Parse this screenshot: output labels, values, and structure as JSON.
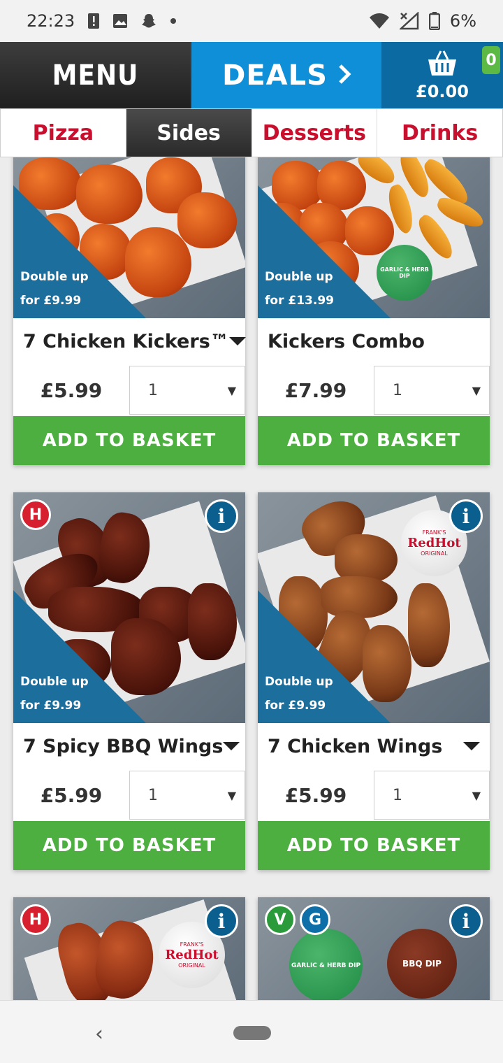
{
  "status_bar": {
    "time": "22:23",
    "battery": "6%"
  },
  "nav": {
    "menu_label": "MENU",
    "deals_label": "DEALS",
    "basket_total": "£0.00",
    "basket_count": "0"
  },
  "categories": [
    {
      "label": "Pizza",
      "active": false
    },
    {
      "label": "Sides",
      "active": true
    },
    {
      "label": "Desserts",
      "active": false
    },
    {
      "label": "Drinks",
      "active": false
    }
  ],
  "products": [
    {
      "title": "7 Chicken Kickers™",
      "price": "£5.99",
      "qty": "1",
      "promo_line1": "Double up",
      "promo_line2": "for £9.99",
      "button": "ADD TO BASKET"
    },
    {
      "title": "Kickers Combo",
      "price": "£7.99",
      "qty": "1",
      "promo_line1": "Double up",
      "promo_line2": "for £13.99",
      "button": "ADD TO BASKET"
    },
    {
      "title": "7 Spicy BBQ Wings",
      "price": "£5.99",
      "qty": "1",
      "promo_line1": "Double up",
      "promo_line2": "for £9.99",
      "badge": "H",
      "button": "ADD TO BASKET"
    },
    {
      "title": "7 Chicken Wings",
      "price": "£5.99",
      "qty": "1",
      "promo_line1": "Double up",
      "promo_line2": "for £9.99",
      "button": "ADD TO BASKET"
    },
    {
      "badge": "H"
    },
    {
      "badge_v": "V",
      "badge_g": "G"
    }
  ],
  "image_text": {
    "garlic_dip": "GARLIC & HERB DIP",
    "bbq_dip": "BBQ DIP",
    "redhot": "RedHot",
    "franks": "FRANK'S",
    "original": "ORIGINAL"
  }
}
